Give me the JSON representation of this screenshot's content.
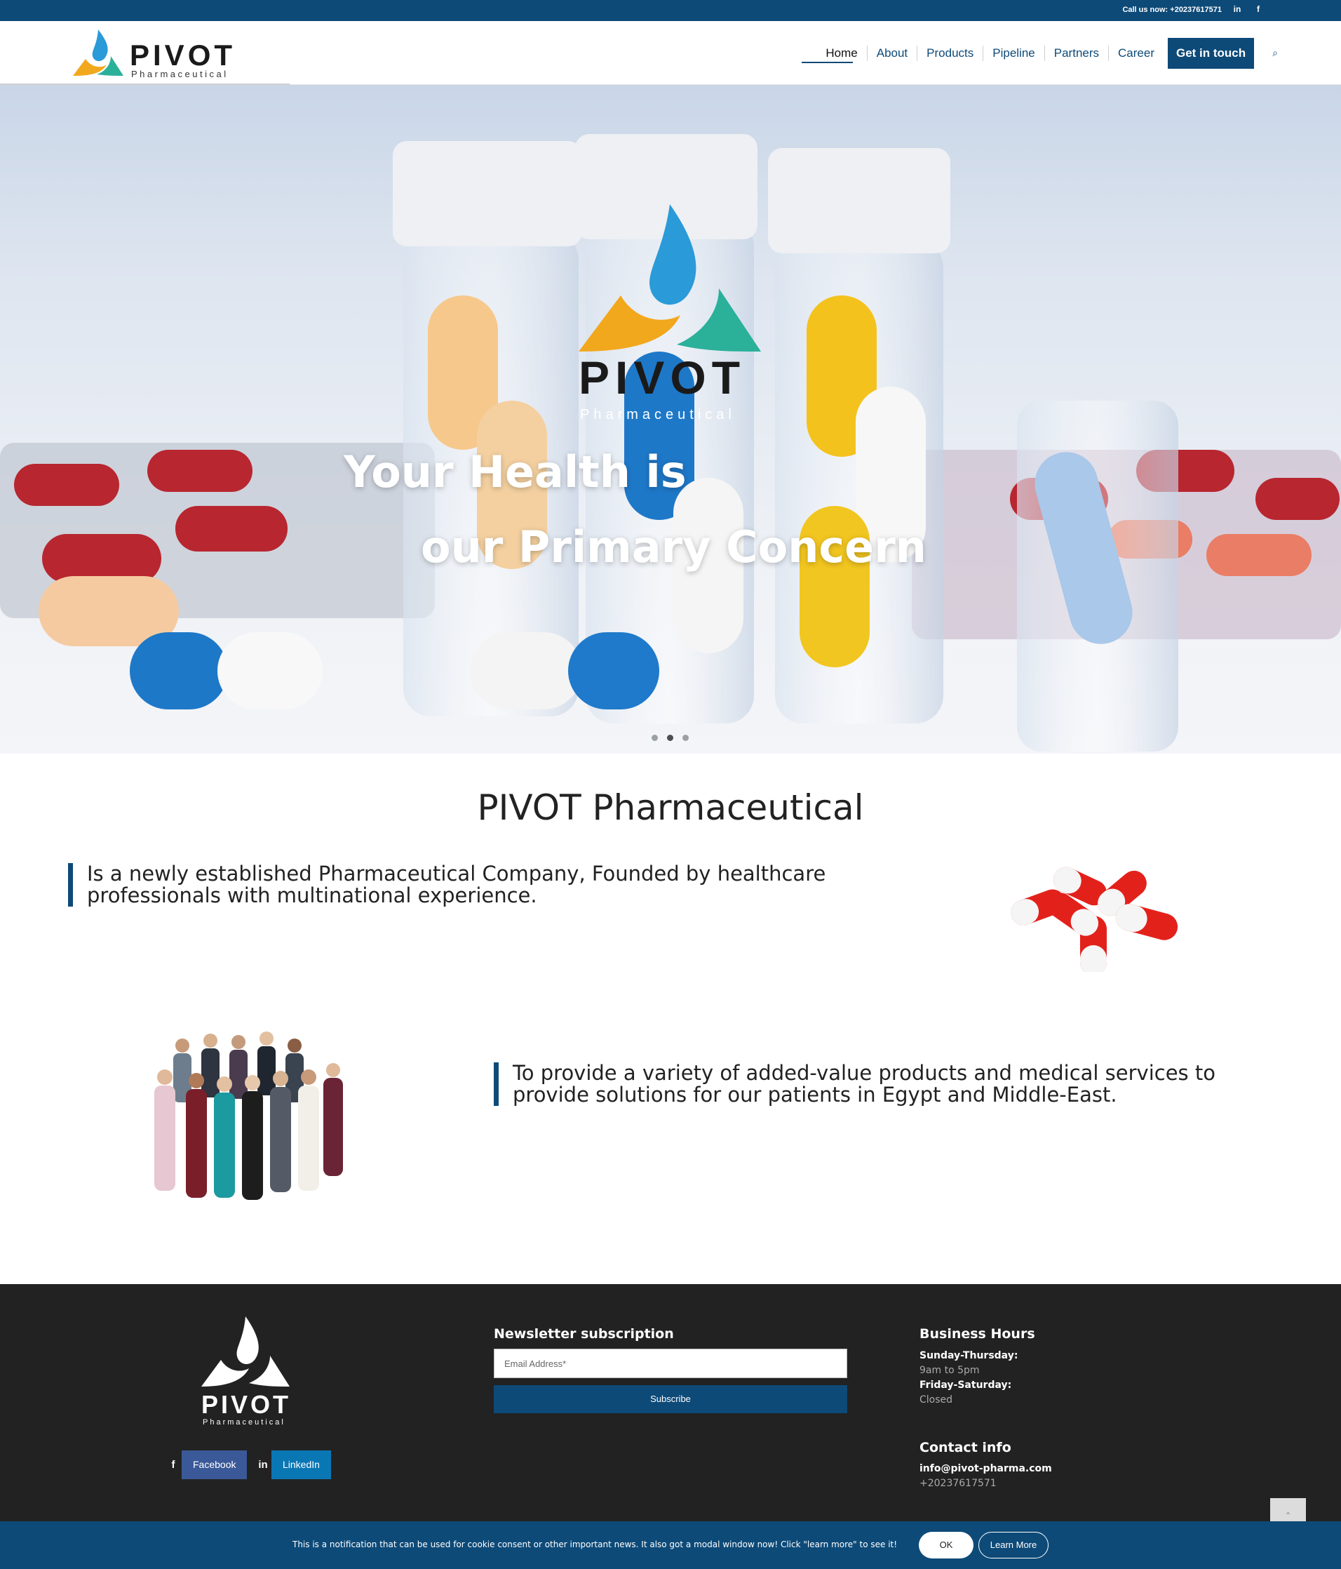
{
  "topbar": {
    "call": "Call us now: +20237617571",
    "social_icons": [
      "linkedin-icon",
      "facebook-icon"
    ],
    "social_glyphs": [
      "in",
      "f"
    ]
  },
  "brand": {
    "name": "PIVOT",
    "sub": "Pharmaceutical"
  },
  "nav": {
    "items": [
      "Home",
      "About",
      "Products",
      "Pipeline",
      "Partners",
      "Career"
    ],
    "cta": "Get in touch",
    "search_icon": "search-icon",
    "search_glyph": "⌕"
  },
  "hero": {
    "line1": "Your Health is",
    "line2": "our Primary Concern",
    "slides": 3,
    "active_slide": 2
  },
  "intro": {
    "title": "PIVOT Pharmaceutical",
    "quote1": "Is a newly established Pharmaceutical Company, Founded by healthcare professionals with multinational experience.",
    "quote2": "To provide a variety of added-value products and medical services to provide solutions for our patients in Egypt and Middle-East."
  },
  "footer": {
    "social": [
      {
        "glyph": "f",
        "label": "Facebook",
        "color": "#3b5998",
        "icon": "facebook-icon"
      },
      {
        "glyph": "in",
        "label": "LinkedIn",
        "color": "#0a77b5",
        "icon": "linkedin-icon"
      }
    ],
    "newsletter": {
      "title": "Newsletter subscription",
      "placeholder": "Email Address*",
      "button": "Subscribe"
    },
    "hours": {
      "title": "Business Hours",
      "d1": "Sunday-Thursday:",
      "t1": "9am to 5pm",
      "d2": "Friday-Saturday:",
      "t2": "Closed"
    },
    "contact": {
      "title": "Contact info",
      "email": "info@pivot-pharma.com",
      "phone": "+20237617571"
    },
    "to_top": "⌃"
  },
  "cookie": {
    "message": "This is a notification that can be used for cookie consent or other important news. It also got a modal window now! Click \"learn more\" to see it!",
    "ok": "OK",
    "learn": "Learn More"
  },
  "colors": {
    "brand_blue": "#0d4a78",
    "footer_bg": "#222222",
    "facebook": "#3b5998",
    "linkedin": "#0a77b5"
  }
}
